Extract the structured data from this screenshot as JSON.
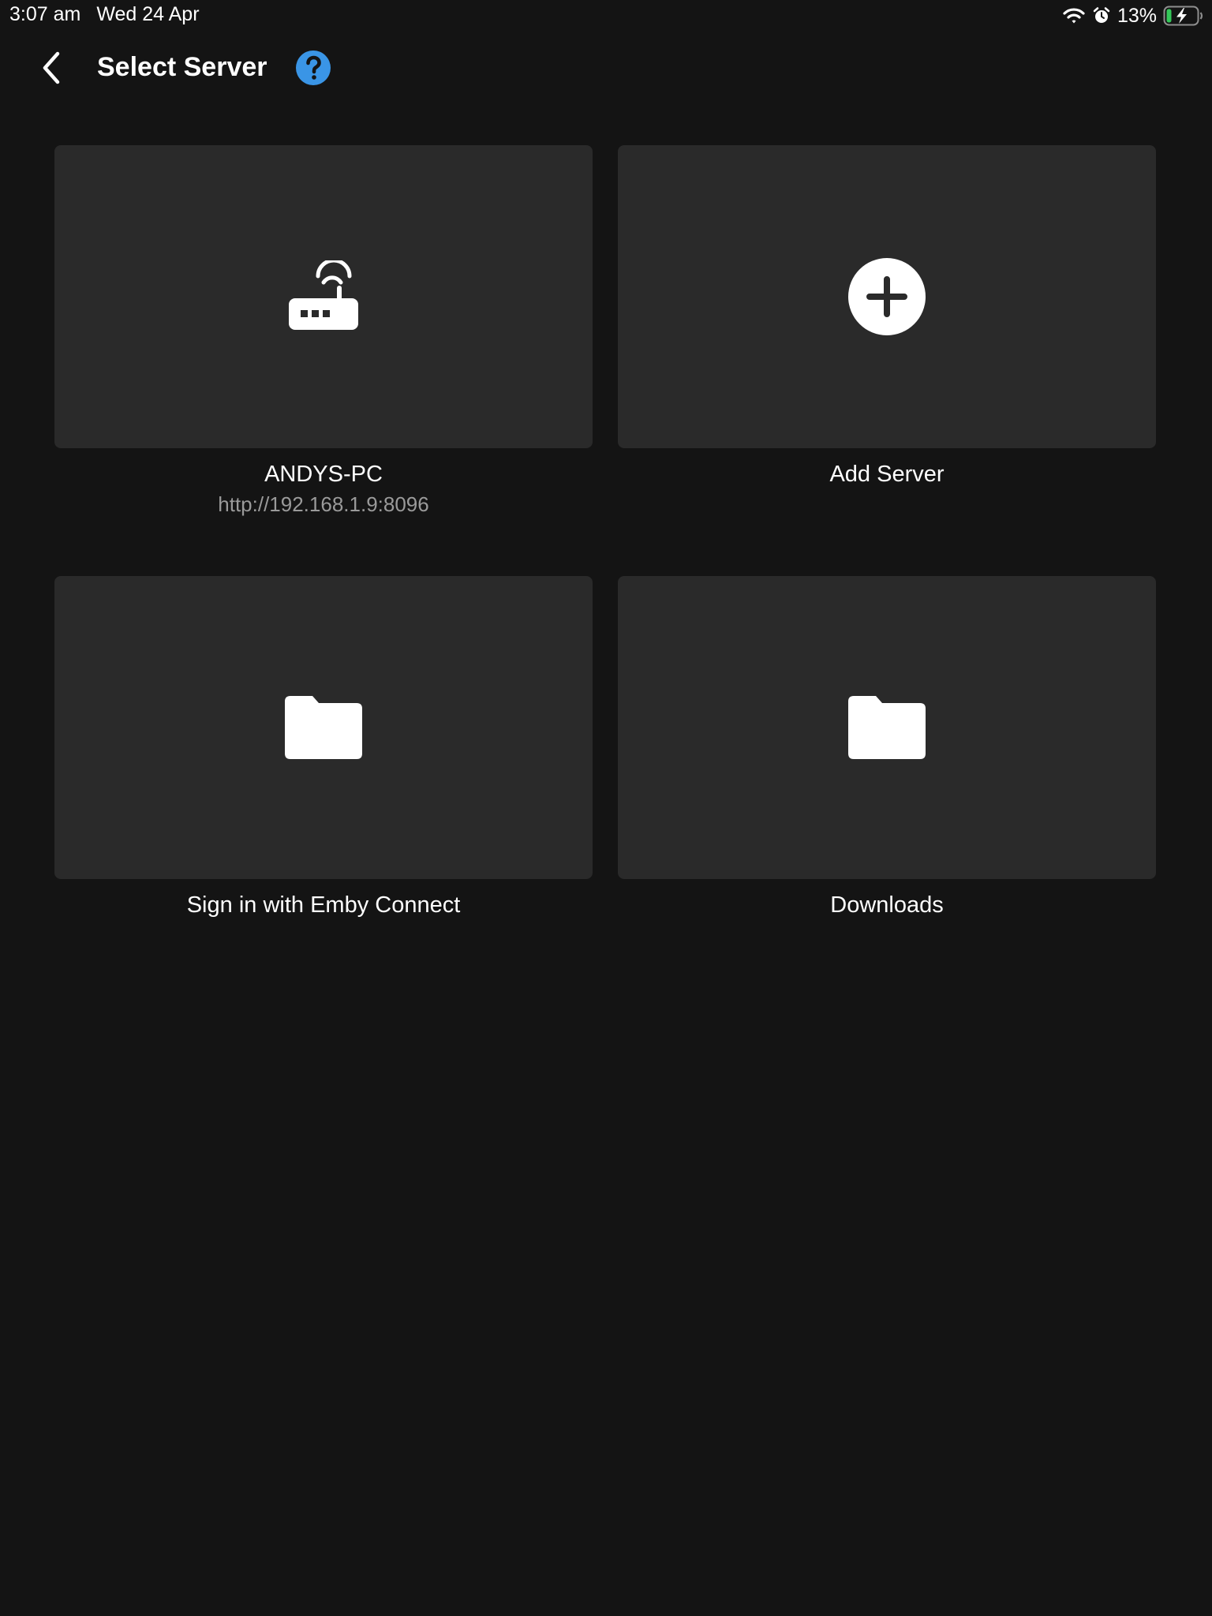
{
  "status_bar": {
    "time": "3:07 am",
    "date": "Wed 24 Apr",
    "battery_percent": "13%",
    "battery_level": 0.13,
    "icons": [
      "wifi-icon",
      "alarm-icon",
      "battery-charging-icon"
    ],
    "battery_color": "#34c759"
  },
  "header": {
    "title": "Select Server",
    "back_icon": "chevron-left-icon",
    "help_icon": "question-mark-icon",
    "help_color": "#3a95e6"
  },
  "cards": [
    {
      "label": "ANDYS-PC",
      "sublabel": "http://192.168.1.9:8096",
      "icon": "router-icon"
    },
    {
      "label": "Add Server",
      "icon": "plus-circle-icon"
    },
    {
      "label": "Sign in with Emby Connect",
      "icon": "folder-icon"
    },
    {
      "label": "Downloads",
      "icon": "folder-icon"
    }
  ],
  "colors": {
    "background": "#141414",
    "card": "#2a2a2a",
    "sublabel": "#9a9a9a"
  }
}
